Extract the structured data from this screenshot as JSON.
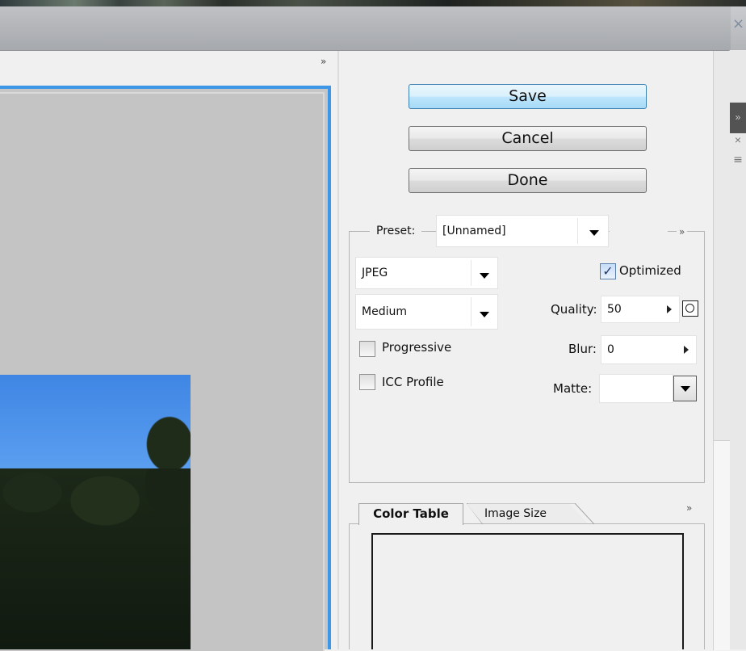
{
  "window": {
    "close_glyph": "×"
  },
  "outer_panel": {
    "expand_glyph": "»",
    "close_glyph": "×",
    "menu_glyph": "≡"
  },
  "preview": {
    "expand_glyph": "»"
  },
  "buttons": {
    "save": "Save",
    "cancel": "Cancel",
    "done": "Done"
  },
  "settings": {
    "preset_label": "Preset:",
    "preset_value": "[Unnamed]",
    "menu_glyph": "»",
    "format_value": "JPEG",
    "quality_preset_value": "Medium",
    "optimized_label": "Optimized",
    "optimized_checked": true,
    "quality_label": "Quality:",
    "quality_value": "50",
    "progressive_label": "Progressive",
    "progressive_checked": false,
    "blur_label": "Blur:",
    "blur_value": "0",
    "icc_label": "ICC Profile",
    "icc_checked": false,
    "matte_label": "Matte:",
    "matte_value": "",
    "check_glyph": "✓"
  },
  "tabs": {
    "items": [
      {
        "label": "Color Table",
        "active": true
      },
      {
        "label": "Image Size",
        "active": false
      }
    ],
    "menu_glyph": "»"
  },
  "colors": {
    "accent_blue": "#3d97e6",
    "save_button": "#bee6fd",
    "preview_gray": "#c6c6c6"
  }
}
